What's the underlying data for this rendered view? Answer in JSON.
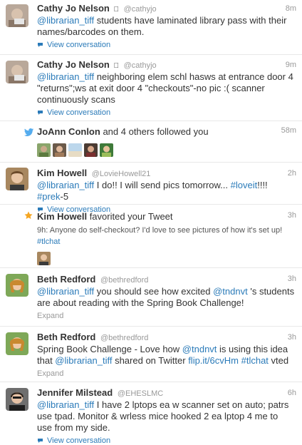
{
  "feed": {
    "items": [
      {
        "kind": "tweet",
        "name": "Cathy Jo Nelson",
        "handle": "@cathyjo",
        "time": "8m",
        "mention": "@librarian_tiff",
        "text": " students have laminated library pass with their names/barcodes on them.",
        "meta": "View conversation"
      },
      {
        "kind": "tweet",
        "name": "Cathy Jo Nelson",
        "handle": "@cathyjo",
        "time": "9m",
        "mention": "@librarian_tiff",
        "text": " neighboring elem schl hasws at entrance door 4 \"returns\";ws at exit door 4 \"checkouts\"-no pic :( scanner continuously scans",
        "meta": "View conversation"
      },
      {
        "kind": "follow",
        "name": "JoAnn Conlon",
        "text": " and 4 others followed you",
        "time": "58m"
      },
      {
        "kind": "tweet",
        "name": "Kim Howell",
        "handle": "@LovieHowell21",
        "time": "2h",
        "mention": "@librarian_tiff",
        "text": " I do!!  I will send pics tomorrow... ",
        "hashtag1": "#loveit",
        "text2": "!!!! ",
        "hashtag2": "#prek",
        "text3": "-5",
        "meta": "View conversation"
      },
      {
        "kind": "favorite",
        "name": "Kim Howell",
        "text": " favorited your Tweet",
        "time": "3h",
        "sub": "9h: Anyone do self-checkout? I'd love to see pictures of how it's set up!",
        "sub_hashtag": "#tlchat"
      },
      {
        "kind": "tweet",
        "name": "Beth Redford",
        "handle": "@bethredford",
        "time": "3h",
        "mention": "@librarian_tiff",
        "text": " you should see how excited ",
        "mention2": "@tndnvt",
        "text2": " 's students are about reading with the Spring Book Challenge!",
        "meta": "Expand"
      },
      {
        "kind": "tweet",
        "name": "Beth Redford",
        "handle": "@bethredford",
        "time": "3h",
        "text0": "Spring Book Challenge - Love how ",
        "mention": "@tndnvt",
        "text": " is using this idea that ",
        "mention2": "@librarian_tiff",
        "text2": "  shared on Twitter ",
        "link": "flip.it/6cvHm",
        "text3": " ",
        "hashtag": "#tlchat",
        "text4": " vted",
        "meta": "Expand"
      },
      {
        "kind": "tweet",
        "name": "Jennifer Milstead",
        "handle": "@EHESLMC",
        "time": "6h",
        "mention": "@librarian_tiff",
        "text": " I have 2 lptops ea w scanner set on auto; patrs use tpad. Monitor & wrless mice hooked 2 ea lptop 4 me to use from my side.",
        "meta": "View conversation"
      }
    ]
  },
  "colors": {
    "link": "#2b7bb9",
    "muted": "#999999",
    "text": "#333333",
    "star": "#f5a623",
    "bird": "#55acee"
  },
  "icons": {
    "apple": "apple-icon",
    "conversation": "conversation-icon",
    "bird": "bird-icon",
    "star": "star-icon"
  }
}
